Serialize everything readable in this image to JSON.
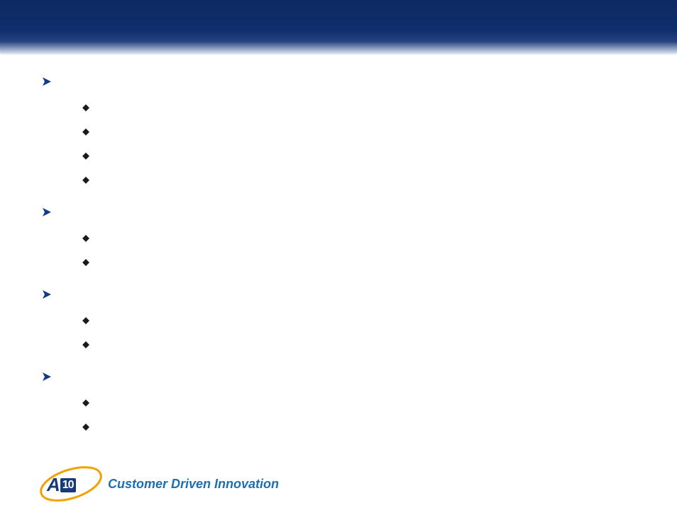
{
  "header": {
    "title": ""
  },
  "sections": [
    {
      "title": "",
      "items": [
        "",
        "",
        "",
        ""
      ]
    },
    {
      "title": "",
      "items": [
        "",
        ""
      ]
    },
    {
      "title": "",
      "items": [
        "",
        ""
      ]
    },
    {
      "title": "",
      "items": [
        "",
        ""
      ]
    }
  ],
  "footer": {
    "logo_text": "A",
    "logo_ten": "10",
    "tagline": "Customer Driven Innovation"
  },
  "colors": {
    "brand_deep": "#0f2e6d",
    "brand_light": "#1e6fb0",
    "orbit": "#f4a100",
    "bullet": "#1a1a1a"
  }
}
